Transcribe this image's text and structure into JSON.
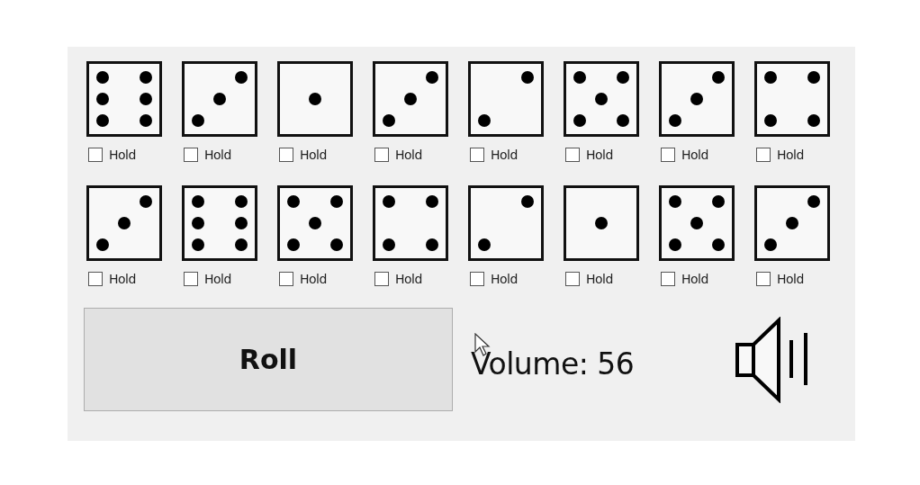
{
  "dice_rows": [
    {
      "dice": [
        {
          "kind": "six",
          "hold_label": "Hold",
          "checked": false
        },
        {
          "kind": "three",
          "hold_label": "Hold",
          "checked": false
        },
        {
          "kind": "one",
          "hold_label": "Hold",
          "checked": false
        },
        {
          "kind": "three",
          "hold_label": "Hold",
          "checked": false
        },
        {
          "kind": "two",
          "hold_label": "Hold",
          "checked": false
        },
        {
          "kind": "five",
          "hold_label": "Hold",
          "checked": false
        },
        {
          "kind": "three",
          "hold_label": "Hold",
          "checked": false
        },
        {
          "kind": "four",
          "hold_label": "Hold",
          "checked": false
        }
      ]
    },
    {
      "dice": [
        {
          "kind": "three",
          "hold_label": "Hold",
          "checked": false
        },
        {
          "kind": "six",
          "hold_label": "Hold",
          "checked": false
        },
        {
          "kind": "five",
          "hold_label": "Hold",
          "checked": false
        },
        {
          "kind": "four",
          "hold_label": "Hold",
          "checked": false
        },
        {
          "kind": "two",
          "hold_label": "Hold",
          "checked": false
        },
        {
          "kind": "one",
          "hold_label": "Hold",
          "checked": false
        },
        {
          "kind": "five",
          "hold_label": "Hold",
          "checked": false
        },
        {
          "kind": "three",
          "hold_label": "Hold",
          "checked": false
        }
      ]
    }
  ],
  "roll_button": "Roll",
  "volume_label": "Volume: 56"
}
